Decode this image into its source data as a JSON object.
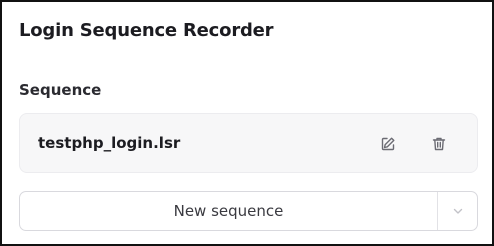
{
  "header": {
    "title": "Login Sequence Recorder"
  },
  "sequence_section": {
    "label": "Sequence",
    "items": [
      {
        "name": "testphp_login.lsr",
        "actions": [
          "edit-icon",
          "trash-icon"
        ]
      }
    ]
  },
  "new_sequence": {
    "label": "New sequence",
    "dropdown_icon": "chevron-down-icon"
  },
  "colors": {
    "border": "#111111",
    "card_background": "#f7f7f8",
    "icon": "#6b6b73",
    "icon_muted": "#c2c2c8"
  }
}
